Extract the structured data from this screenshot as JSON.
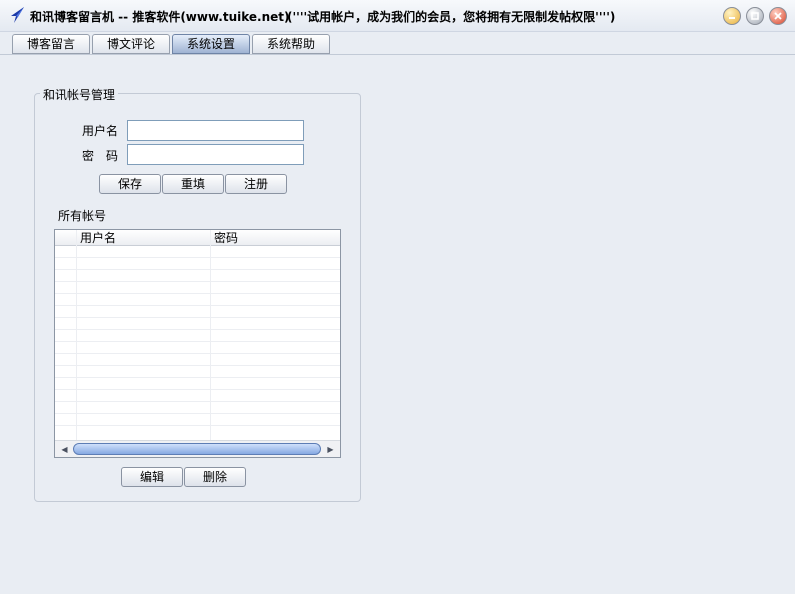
{
  "window": {
    "title": "和讯博客留言机 -- 推客软件(www.tuike.net)",
    "notice": "(''''试用帐户，成为我们的会员，您将拥有无限制发帖权限'''')",
    "icons": {
      "app": "arrow-app-icon",
      "minimize": "minimize-icon",
      "maximize": "maximize-icon",
      "close": "close-icon"
    }
  },
  "tabs": [
    {
      "label": "博客留言",
      "active": false
    },
    {
      "label": "博文评论",
      "active": false
    },
    {
      "label": "系统设置",
      "active": true
    },
    {
      "label": "系统帮助",
      "active": false
    }
  ],
  "account_group": {
    "title": "和讯帐号管理",
    "username_label": "用户名",
    "password_label": "密　码",
    "username_value": "",
    "password_value": "",
    "buttons": {
      "save": "保存",
      "reset": "重填",
      "register": "注册"
    }
  },
  "accounts_list": {
    "label": "所有帐号",
    "columns": [
      "用户名",
      "密码"
    ],
    "rows": []
  },
  "list_buttons": {
    "edit": "编辑",
    "delete": "删除"
  }
}
